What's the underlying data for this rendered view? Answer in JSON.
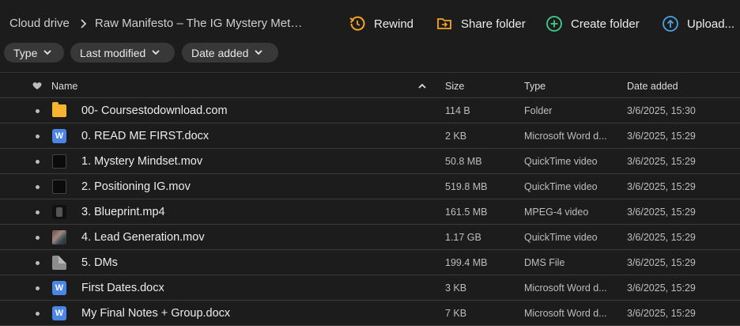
{
  "breadcrumb": {
    "root": "Cloud drive",
    "current": "Raw Manifesto – The IG Mystery Meth..."
  },
  "actions": {
    "rewind": "Rewind",
    "share_folder": "Share folder",
    "create_folder": "Create folder",
    "upload": "Upload..."
  },
  "filters": {
    "type": "Type",
    "last_modified": "Last modified",
    "date_added": "Date added"
  },
  "columns": {
    "name": "Name",
    "size": "Size",
    "type": "Type",
    "date_added": "Date added"
  },
  "files": [
    {
      "name": "00- Coursestodownload.com",
      "size": "114 B",
      "type": "Folder",
      "date": "3/6/2025, 15:30",
      "icon": "folder-icon"
    },
    {
      "name": "0. READ ME FIRST.docx",
      "size": "2 KB",
      "type": "Microsoft Word d...",
      "date": "3/6/2025, 15:29",
      "icon": "word-doc-icon",
      "icon_letter": "W"
    },
    {
      "name": "1. Mystery Mindset.mov",
      "size": "50.8 MB",
      "type": "QuickTime video",
      "date": "3/6/2025, 15:29",
      "icon": "video-thumbnail-icon"
    },
    {
      "name": "2. Positioning IG.mov",
      "size": "519.8 MB",
      "type": "QuickTime video",
      "date": "3/6/2025, 15:29",
      "icon": "video-thumbnail-icon"
    },
    {
      "name": "3. Blueprint.mp4",
      "size": "161.5 MB",
      "type": "MPEG-4 video",
      "date": "3/6/2025, 15:29",
      "icon": "video-thumbnail-icon"
    },
    {
      "name": "4. Lead Generation.mov",
      "size": "1.17 GB",
      "type": "QuickTime video",
      "date": "3/6/2025, 15:29",
      "icon": "video-thumbnail-icon"
    },
    {
      "name": "5. DMs",
      "size": "199.4 MB",
      "type": "DMS File",
      "date": "3/6/2025, 15:29",
      "icon": "generic-file-icon"
    },
    {
      "name": "First Dates.docx",
      "size": "3 KB",
      "type": "Microsoft Word d...",
      "date": "3/6/2025, 15:29",
      "icon": "word-doc-icon",
      "icon_letter": "W"
    },
    {
      "name": "My Final Notes + Group.docx",
      "size": "7 KB",
      "type": "Microsoft Word d...",
      "date": "3/6/2025, 15:29",
      "icon": "word-doc-icon",
      "icon_letter": "W"
    }
  ],
  "colors": {
    "background": "#1c1c1c",
    "rewind_accent": "#f5a623",
    "share_accent": "#f5a623",
    "create_accent": "#3ecf8e",
    "upload_accent": "#4aa3df",
    "folder": "#f5b52e",
    "word": "#4a86e8"
  }
}
